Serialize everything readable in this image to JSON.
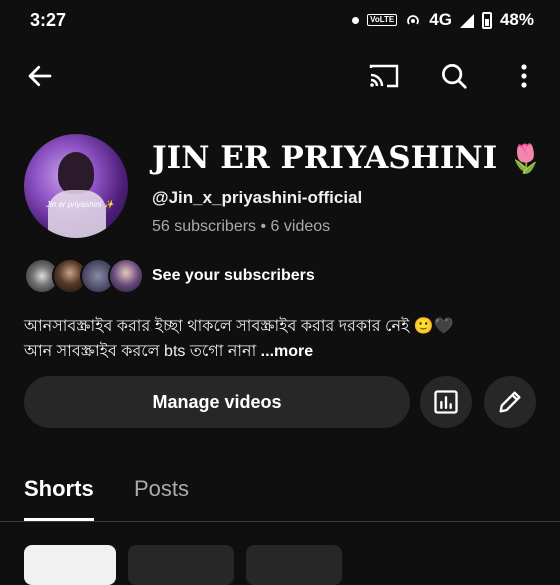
{
  "status_bar": {
    "time": "3:27",
    "volte": "VoLTE",
    "network": "4G",
    "battery": "48%"
  },
  "top_bar": {
    "back_icon": "arrow-left-icon",
    "cast_icon": "cast-icon",
    "search_icon": "search-icon",
    "more_icon": "more-vert-icon"
  },
  "channel": {
    "title": "JIN ER PRIYASHINI",
    "title_emoji": "🌷",
    "avatar_signature": "Jin er priyashini ✨",
    "handle": "@Jin_x_priyashini-official",
    "stats": "56 subscribers • 6 videos"
  },
  "subscribers": {
    "label": "See your subscribers"
  },
  "description": {
    "line1": "আনসাবস্ক্রাইব করার ইচ্ছা থাকলে সাবস্ক্রাইব করার দরকার নেই 🙂🖤",
    "line2": "আন সাবস্ক্রাইব করলে bts তগো নানা ",
    "more": "...more"
  },
  "actions": {
    "manage_videos": "Manage videos",
    "analytics_icon": "analytics-icon",
    "edit_icon": "pencil-icon"
  },
  "tabs": [
    {
      "label": "Shorts",
      "active": true
    },
    {
      "label": "Posts",
      "active": false
    }
  ]
}
